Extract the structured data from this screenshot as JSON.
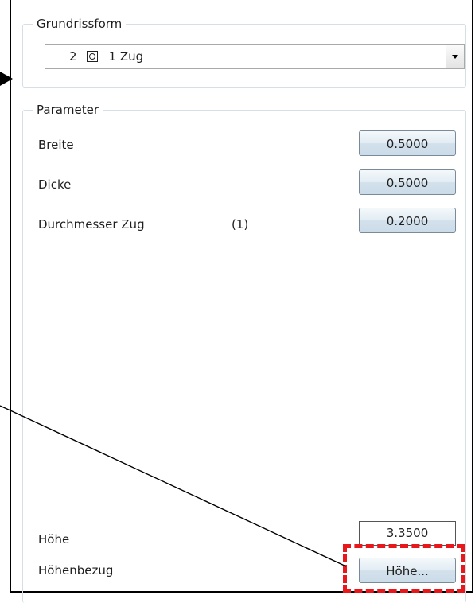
{
  "grundrissform": {
    "title": "Grundrissform",
    "selected_number": "2",
    "selected_icon": "square-circle-icon",
    "selected_text": "1 Zug"
  },
  "parameter": {
    "title": "Parameter",
    "rows": [
      {
        "label": "Breite",
        "note": "",
        "value": "0.5000"
      },
      {
        "label": "Dicke",
        "note": "",
        "value": "0.5000"
      },
      {
        "label": "Durchmesser Zug",
        "note": "(1)",
        "value": "0.2000"
      }
    ],
    "hoehe": {
      "label": "Höhe",
      "value": "3.3500"
    },
    "hoehenbezug": {
      "label": "Höhenbezug",
      "button": "Höhe..."
    }
  },
  "colors": {
    "highlight": "#e8171b",
    "group_border": "#d5dfe5",
    "button_top": "#f4f8fb",
    "button_bottom": "#cbdbe8"
  }
}
